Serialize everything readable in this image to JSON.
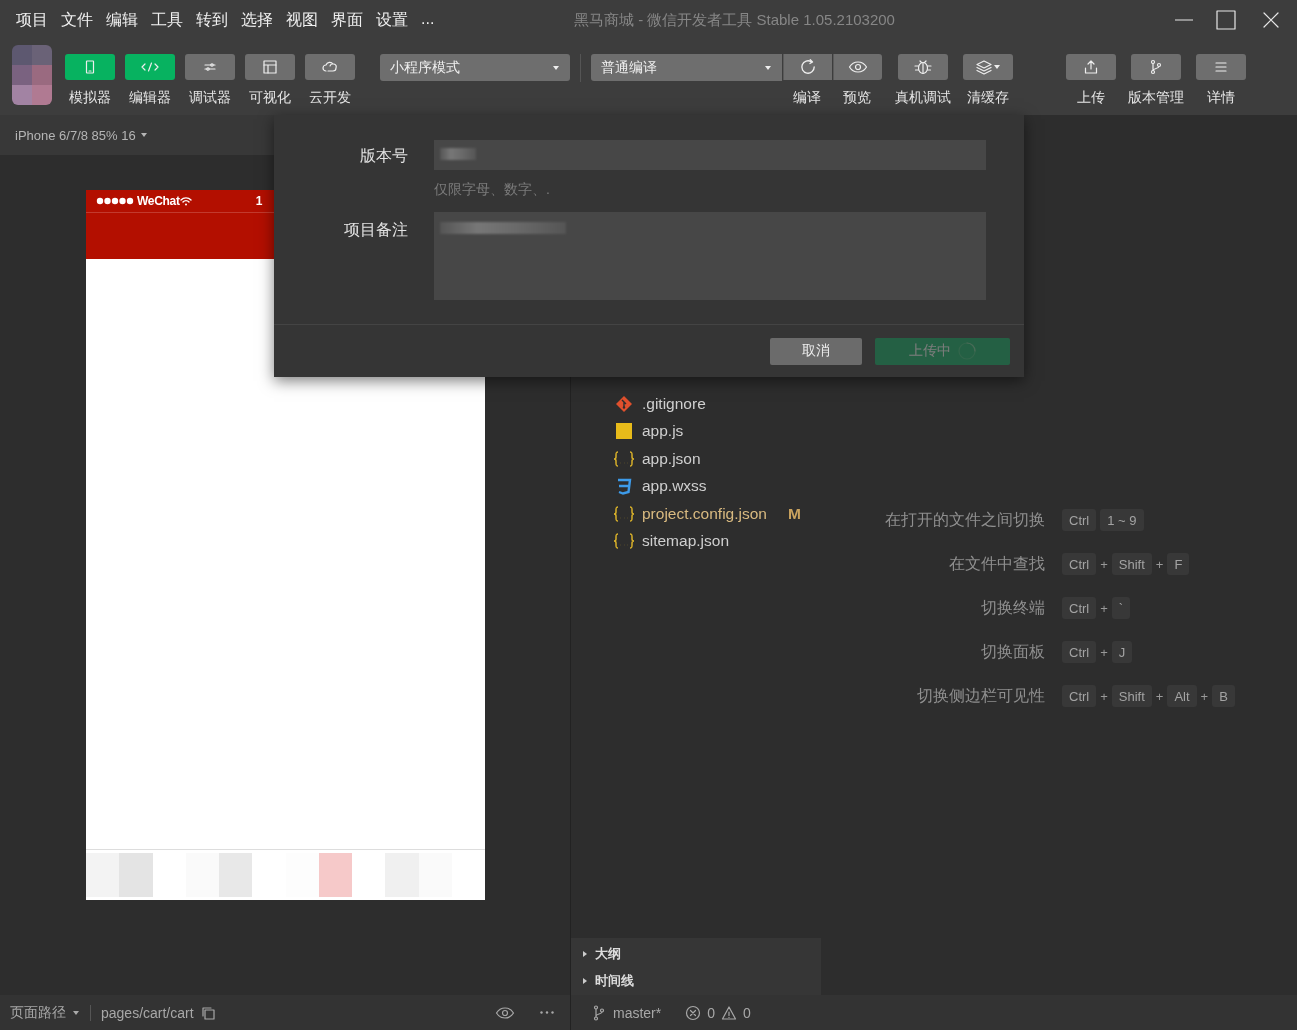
{
  "window": {
    "title": "黑马商城 - 微信开发者工具 Stable 1.05.2103200"
  },
  "menu": [
    "项目",
    "文件",
    "编辑",
    "工具",
    "转到",
    "选择",
    "视图",
    "界面",
    "设置",
    "..."
  ],
  "toolbar": {
    "views": [
      {
        "label": "模拟器",
        "on": true
      },
      {
        "label": "编辑器",
        "on": true
      },
      {
        "label": "调试器",
        "on": false
      },
      {
        "label": "可视化",
        "on": false
      },
      {
        "label": "云开发",
        "on": false
      }
    ],
    "mode_dropdown": "小程序模式",
    "compile_dropdown": "普通编译",
    "compile_actions": [
      {
        "label": "编译"
      },
      {
        "label": "预览"
      }
    ],
    "actions": [
      {
        "label": "真机调试",
        "menu": false
      },
      {
        "label": "清缓存",
        "menu": true
      }
    ],
    "right_actions": [
      {
        "label": "上传"
      },
      {
        "label": "版本管理"
      },
      {
        "label": "详情"
      }
    ]
  },
  "simulator": {
    "device": "iPhone 6/7/8 85% 16",
    "carrier": "WeChat",
    "time": "1"
  },
  "files": [
    {
      "name": ".gitignore",
      "kind": "git",
      "modified": false
    },
    {
      "name": "app.js",
      "kind": "js",
      "modified": false
    },
    {
      "name": "app.json",
      "kind": "json",
      "modified": false
    },
    {
      "name": "app.wxss",
      "kind": "css",
      "modified": false
    },
    {
      "name": "project.config.json",
      "kind": "json",
      "modified": true,
      "status": "M"
    },
    {
      "name": "sitemap.json",
      "kind": "json",
      "modified": false
    }
  ],
  "panels": [
    {
      "label": "大纲",
      "expanded": false
    },
    {
      "label": "时间线",
      "expanded": false
    }
  ],
  "shortcuts": [
    {
      "label": "在打开的文件之间切换",
      "keys": [
        {
          "kind": "key",
          "text": "Ctrl"
        },
        {
          "kind": "key",
          "text": "1 ~ 9"
        }
      ]
    },
    {
      "label": "在文件中查找",
      "keys": [
        {
          "kind": "key",
          "text": "Ctrl"
        },
        {
          "kind": "plus",
          "text": "+"
        },
        {
          "kind": "key",
          "text": "Shift"
        },
        {
          "kind": "plus",
          "text": "+"
        },
        {
          "kind": "key",
          "text": "F"
        }
      ]
    },
    {
      "label": "切换终端",
      "keys": [
        {
          "kind": "key",
          "text": "Ctrl"
        },
        {
          "kind": "plus",
          "text": "+"
        },
        {
          "kind": "key",
          "text": "`"
        }
      ]
    },
    {
      "label": "切换面板",
      "keys": [
        {
          "kind": "key",
          "text": "Ctrl"
        },
        {
          "kind": "plus",
          "text": "+"
        },
        {
          "kind": "key",
          "text": "J"
        }
      ]
    },
    {
      "label": "切换侧边栏可见性",
      "keys": [
        {
          "kind": "key",
          "text": "Ctrl"
        },
        {
          "kind": "plus",
          "text": "+"
        },
        {
          "kind": "key",
          "text": "Shift"
        },
        {
          "kind": "plus",
          "text": "+"
        },
        {
          "kind": "key",
          "text": "Alt"
        },
        {
          "kind": "plus",
          "text": "+"
        },
        {
          "kind": "key",
          "text": "B"
        }
      ]
    }
  ],
  "dialog": {
    "fields": [
      {
        "label": "版本号",
        "kind": "input",
        "hint": "仅限字母、数字、."
      },
      {
        "label": "项目备注",
        "kind": "textarea"
      }
    ],
    "buttons": [
      {
        "label": "取消",
        "kind": "cancel",
        "disabled": false,
        "loading": false
      },
      {
        "label": "上传中",
        "kind": "primary",
        "disabled": true,
        "loading": true
      }
    ]
  },
  "status_bar": {
    "page_path_label": "页面路径",
    "page_path": "pages/cart/cart",
    "branch": "master*",
    "errors": "0",
    "warnings": "0"
  }
}
